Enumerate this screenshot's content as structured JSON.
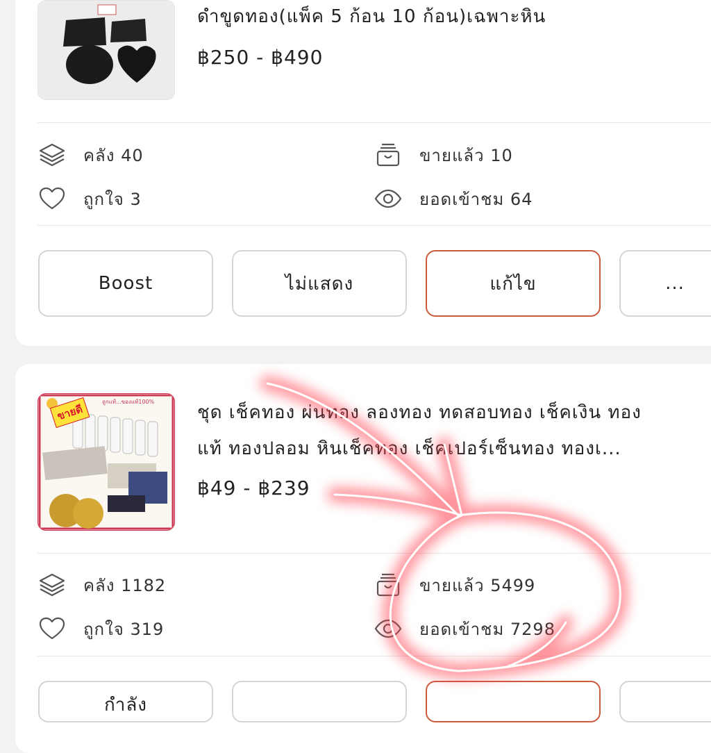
{
  "products": [
    {
      "title": "ดำขูดทอง(แพ็ค 5 ก้อน 10 ก้อน)เฉพาะหิน",
      "price": "฿250 - ฿490",
      "stats": {
        "stock": "คลัง 40",
        "sold": "ขายแล้ว 10",
        "likes": "ถูกใจ 3",
        "views": "ยอดเข้าชม 64"
      },
      "buttons": {
        "boost": "Boost",
        "hide": "ไม่แสดง",
        "edit": "แก้ไข",
        "more": "..."
      }
    },
    {
      "title_line1": "ชุด เช็คทอง ผ่นทอง ลองทอง ทดสอบทอง เช็คเงิน  ทอง",
      "title_line2": "แท้ ทองปลอม  หินเช็คทอง     เช็คเปอร์เซ็นทอง ทองเ...",
      "price": "฿49 - ฿239",
      "badge": "ขายดี",
      "thumb_text": "ถูกแท้...ของแท้100%",
      "stats": {
        "stock": "คลัง 1182",
        "sold": "ขายแล้ว 5499",
        "likes": "ถูกใจ 319",
        "views": "ยอดเข้าชม 7298"
      },
      "buttons": {
        "first": "กำลัง"
      }
    }
  ],
  "colors": {
    "accent": "#cc5a3c",
    "annotation": "#ff3b4a"
  },
  "icons": {
    "stock": "layers-icon",
    "sold": "sold-box-icon",
    "likes": "heart-icon",
    "views": "eye-icon"
  }
}
